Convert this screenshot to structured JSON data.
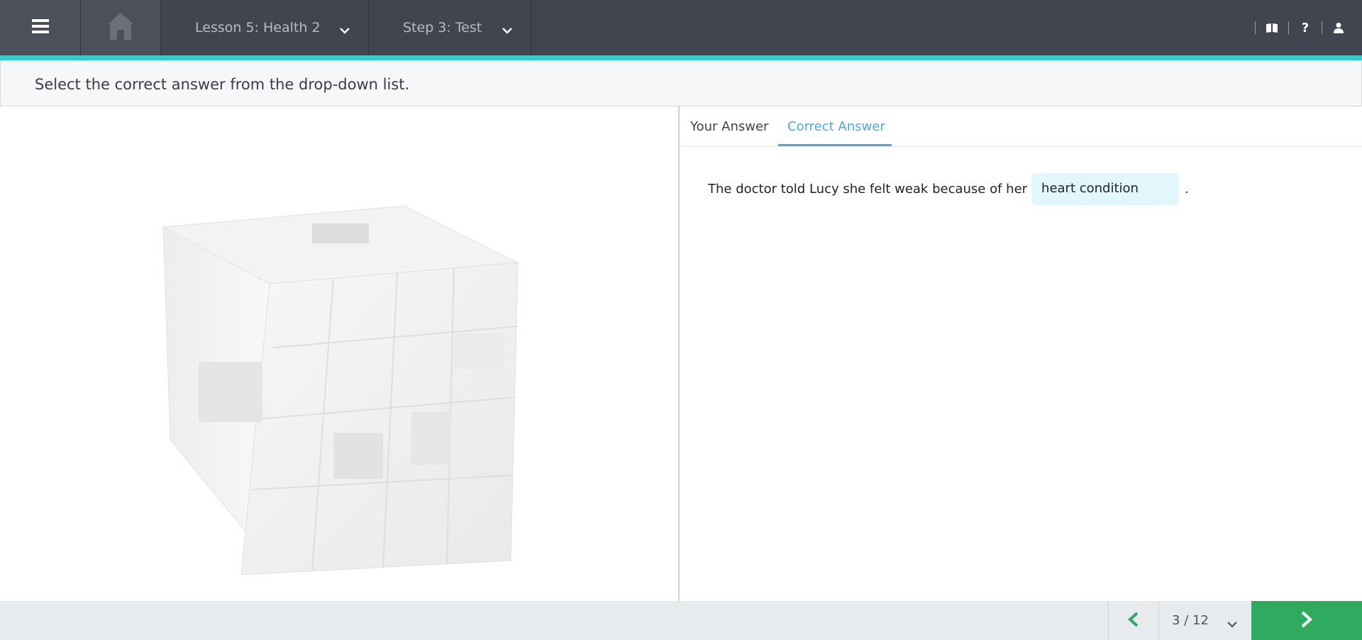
{
  "header": {
    "lesson_label": "Lesson 5: Health 2",
    "step_label": "Step 3: Test",
    "icons": [
      "menu-icon",
      "home-icon",
      "chevron-down-icon",
      "book-icon",
      "help-icon",
      "user-icon"
    ]
  },
  "instruction": {
    "text": "Select the correct answer from the drop-down list."
  },
  "tabs": [
    {
      "label": "Your Answer",
      "active": false
    },
    {
      "label": "Correct Answer",
      "active": true
    }
  ],
  "question": {
    "prefix": "The doctor told Lucy she felt weak because of her",
    "answer": "heart condition",
    "suffix": "."
  },
  "footer": {
    "page_indicator": "3 / 12"
  },
  "colors": {
    "topbar": "#41454f",
    "accent": "#3cc8c8",
    "tab_active": "#4fa9d8",
    "answer_bg": "#e2f7fb",
    "next_button": "#2eab5e",
    "prev_arrow": "#2eab5e"
  }
}
